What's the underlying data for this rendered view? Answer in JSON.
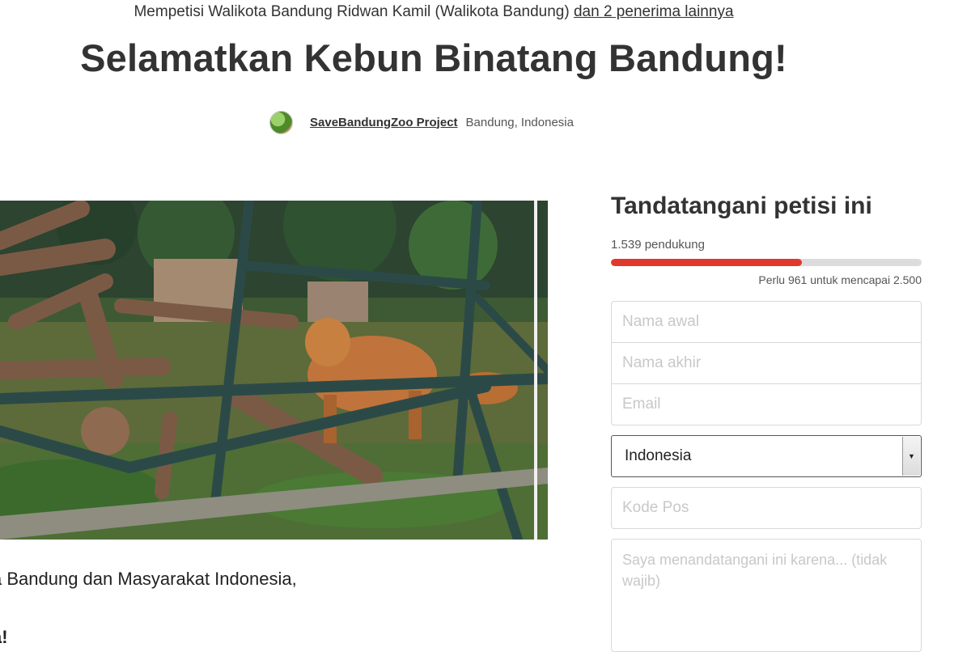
{
  "header": {
    "recipients_text": "Mempetisi Walikota Bandung Ridwan Kamil (Walikota Bandung)",
    "more_recipients": "dan 2 penerima lainnya",
    "title": "Selamatkan Kebun Binatang Bandung!",
    "author": "SaveBandungZoo Project",
    "location": "Bandung, Indonesia"
  },
  "letter": {
    "line1": "a Bandung dan Masyarakat Indonesia,",
    "line2": "a!"
  },
  "sign": {
    "heading": "Tandatangani petisi ini",
    "supporters": "1.539 pendukung",
    "progress_fraction": 0.6156,
    "needed": "Perlu 961 untuk mencapai 2.500",
    "progress_color": "#e0392b"
  },
  "form": {
    "first_name_placeholder": "Nama awal",
    "last_name_placeholder": "Nama akhir",
    "email_placeholder": "Email",
    "country_value": "Indonesia",
    "postal_placeholder": "Kode Pos",
    "reason_placeholder": "Saya menandatangani ini karena... (tidak wajib)"
  },
  "icons": {
    "avatar": "avatar-icon",
    "select_arrow": "chevron-down-icon"
  }
}
